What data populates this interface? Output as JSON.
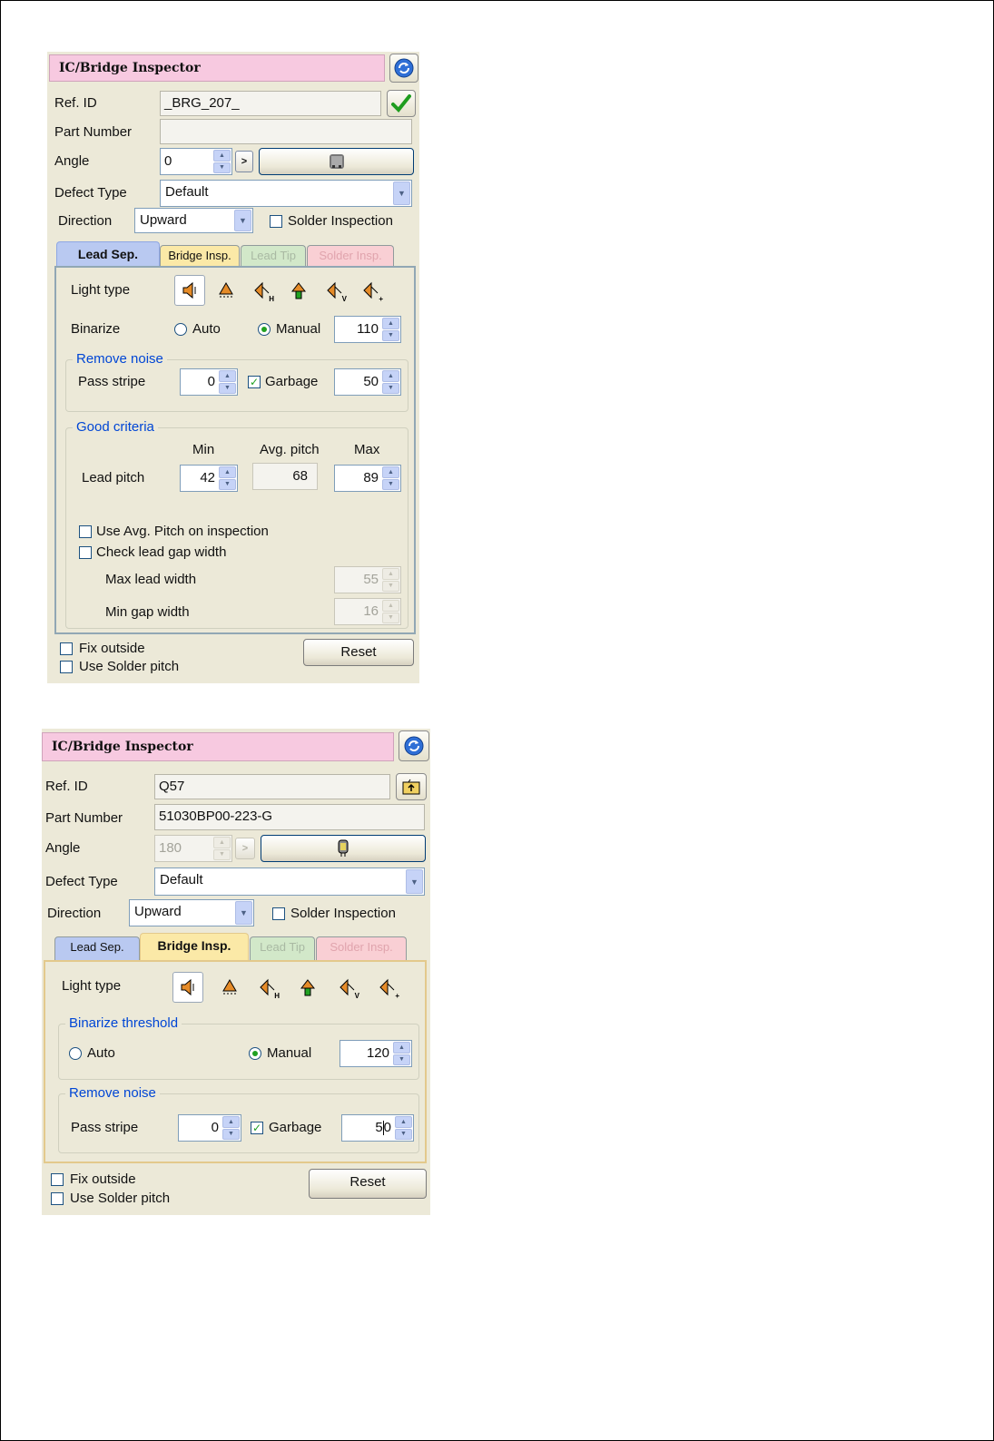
{
  "panel1": {
    "title": "IC/Bridge Inspector",
    "ref_id_label": "Ref. ID",
    "ref_id_value": "_BRG_207_",
    "part_number_label": "Part Number",
    "part_number_value": "",
    "angle_label": "Angle",
    "angle_value": "0",
    "angle_go_label": ">",
    "defect_type_label": "Defect Type",
    "defect_type_value": "Default",
    "direction_label": "Direction",
    "direction_value": "Upward",
    "solder_inspection_label": "Solder Inspection",
    "tabs": [
      "Lead Sep.",
      "Bridge Insp.",
      "Lead Tip",
      "Solder Insp."
    ],
    "active_tab": "Lead Sep.",
    "light_type_label": "Light type",
    "binarize_label": "Binarize",
    "auto_label": "Auto",
    "manual_label": "Manual",
    "binarize_value": "110",
    "remove_noise_label": "Remove noise",
    "pass_stripe_label": "Pass stripe",
    "pass_stripe_value": "0",
    "garbage_label": "Garbage",
    "garbage_value": "50",
    "good_criteria_label": "Good criteria",
    "min_label": "Min",
    "avg_pitch_label": "Avg. pitch",
    "max_label": "Max",
    "lead_pitch_label": "Lead pitch",
    "lead_pitch_min": "42",
    "lead_pitch_avg": "68",
    "lead_pitch_max": "89",
    "use_avg_pitch_label": "Use Avg. Pitch on inspection",
    "check_gap_label": "Check lead  gap width",
    "max_lead_width_label": "Max lead width",
    "max_lead_width_value": "55",
    "min_gap_width_label": "Min gap width",
    "min_gap_width_value": "16",
    "fix_outside_label": "Fix outside",
    "use_solder_pitch_label": "Use Solder pitch",
    "reset_label": "Reset"
  },
  "panel2": {
    "title": "IC/Bridge Inspector",
    "ref_id_label": "Ref. ID",
    "ref_id_value": "Q57",
    "part_number_label": "Part Number",
    "part_number_value": "51030BP00-223-G",
    "angle_label": "Angle",
    "angle_value": "180",
    "angle_go_label": ">",
    "defect_type_label": "Defect Type",
    "defect_type_value": "Default",
    "direction_label": "Direction",
    "direction_value": "Upward",
    "solder_inspection_label": "Solder Inspection",
    "tabs": [
      "Lead Sep.",
      "Bridge Insp.",
      "Lead Tip",
      "Solder Insp."
    ],
    "active_tab": "Bridge Insp.",
    "light_type_label": "Light type",
    "binarize_threshold_label": "Binarize threshold",
    "auto_label": "Auto",
    "manual_label": "Manual",
    "binarize_value": "120",
    "remove_noise_label": "Remove noise",
    "pass_stripe_label": "Pass stripe",
    "pass_stripe_value": "0",
    "garbage_label": "Garbage",
    "garbage_value_a": "5",
    "garbage_value_b": "0",
    "fix_outside_label": "Fix outside",
    "use_solder_pitch_label": "Use Solder pitch",
    "reset_label": "Reset"
  },
  "icons": {
    "light_types": [
      "speaker-light-icon",
      "ring-light-icon",
      "light-h-icon",
      "light-up-icon",
      "light-v-icon",
      "light-plus-icon"
    ],
    "light_letters": [
      "",
      "",
      "H",
      "",
      "V",
      "+"
    ]
  },
  "colors": {
    "panel_bg": "#ECE9D8",
    "title_bg": "#F7C9E0",
    "tab_lead_sep": "#B9C9F1",
    "tab_bridge": "#FBE9A7",
    "tab_lead_tip": "#D2E8C9",
    "tab_solder": "#F9CFD4",
    "group_label": "#0046D5",
    "check_green": "#21A121",
    "bridge_border": "#E3C98C"
  }
}
